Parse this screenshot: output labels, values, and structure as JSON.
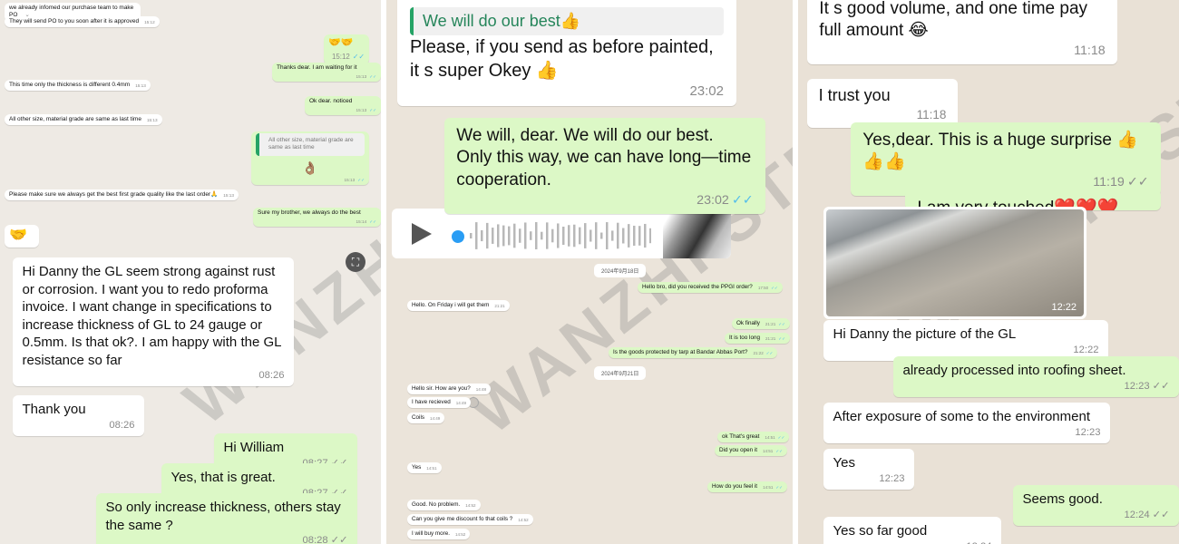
{
  "watermark": "WANZHI STEEL",
  "colors": {
    "incoming": "#ffffff",
    "outgoing": "#dcf8c6",
    "read_ticks": "#53bdeb",
    "quote_bar": "#25a366"
  },
  "left": {
    "messages": [
      {
        "dir": "in",
        "text": "we already infomed our purchase team to make PO",
        "time": "",
        "menu": "chevron-down"
      },
      {
        "dir": "in",
        "text": "They will send PO to you soon after it is approved",
        "time": "15:12"
      },
      {
        "dir": "out",
        "text": "🤝🤝",
        "time": "15:12",
        "ticks": "✓✓"
      },
      {
        "dir": "out",
        "text": "Thanks dear. I am waiting for it",
        "time": "15:13",
        "ticks": "✓✓"
      },
      {
        "dir": "in",
        "text": "This time only the thickness is different 0.4mm",
        "time": "15:13"
      },
      {
        "dir": "out",
        "text": "Ok dear. noticed",
        "time": "15:13",
        "ticks": "✓✓"
      },
      {
        "dir": "in",
        "text": "All other size, material grade are same as last time",
        "time": "15:13"
      },
      {
        "dir": "out",
        "quote": "All other size, material grade are same as last time",
        "text": "👌🏽",
        "time": "15:13",
        "ticks": "✓✓"
      },
      {
        "dir": "in",
        "text": "Please make sure we always get the best first grade quality like the last order🙏",
        "time": "15:13"
      },
      {
        "dir": "out",
        "text": "Sure my brother, we always do the best",
        "time": "15:14",
        "ticks": "✓✓"
      },
      {
        "dir": "in",
        "text": "🤝",
        "time": ""
      },
      {
        "dir": "in",
        "text": "Hi Danny the GL seem strong against rust or corrosion. I want you to redo proforma invoice. I want change in specifications to increase thickness of GL to 24 gauge or 0.5mm. Is that ok?. I am happy with the GL resistance so far",
        "time": "08:26"
      },
      {
        "dir": "in",
        "text": "Thank you",
        "time": "08:26"
      },
      {
        "dir": "out",
        "text": "Hi William",
        "time": "08:27",
        "ticks": "✓✓"
      },
      {
        "dir": "out",
        "text": "Yes, that is great.",
        "time": "08:27",
        "ticks": "✓✓"
      },
      {
        "dir": "out",
        "text": "So only increase thickness, others stay the same ?",
        "time": "08:28",
        "ticks": "✓✓"
      }
    ]
  },
  "middle": {
    "messages": [
      {
        "dir": "in",
        "quote": "We will do our best👍",
        "text": "Please, if you send as before painted, it s super Okey 👍",
        "time": "23:02"
      },
      {
        "dir": "out",
        "text": "We will, dear. We will do our best. Only this way, we can have long—time cooperation.",
        "time": "23:02",
        "ticks": "✓✓"
      },
      {
        "dir": "out",
        "text": "Hello bro, did you received the PPGI order?",
        "time": "17:50",
        "ticks": "✓✓"
      },
      {
        "dir": "in",
        "text": "Hello. On Friday i will get them",
        "time": "21:21"
      },
      {
        "dir": "out",
        "text": "Ok finally",
        "time": "21:21",
        "ticks": "✓✓"
      },
      {
        "dir": "out",
        "text": "It is too long",
        "time": "21:21",
        "ticks": "✓✓"
      },
      {
        "dir": "out",
        "text": "Is the goods protected by tarp at Bandar Abbas Port?",
        "time": "21:22",
        "ticks": "✓✓"
      },
      {
        "dir": "in",
        "text": "Hello sir. How are you?",
        "time": "14:48"
      },
      {
        "dir": "in",
        "text": "I have recieved",
        "time": "14:49"
      },
      {
        "dir": "in",
        "text": "Coils",
        "time": "14:49"
      },
      {
        "dir": "out",
        "text": "ok That's great",
        "time": "14:51",
        "ticks": "✓✓"
      },
      {
        "dir": "out",
        "text": "Did you open it",
        "time": "14:51",
        "ticks": "✓✓"
      },
      {
        "dir": "in",
        "text": "Yes",
        "time": "14:51"
      },
      {
        "dir": "out",
        "text": "How do you feel it",
        "time": "14:51",
        "ticks": "✓✓"
      },
      {
        "dir": "in",
        "text": "Good. No problem.",
        "time": "14:52"
      },
      {
        "dir": "in",
        "text": "Can you give me discount fo that coils ?",
        "time": "14:52"
      },
      {
        "dir": "in",
        "text": "I will buy more.",
        "time": "14:52"
      }
    ],
    "dates": [
      "2024年9月18日",
      "2024年9月21日"
    ],
    "voice": {
      "icon": "play-icon"
    }
  },
  "right": {
    "messages": [
      {
        "dir": "in",
        "text": "It s good volume, and one time pay full amount 😂",
        "time": "11:18"
      },
      {
        "dir": "in",
        "text": "I trust you",
        "time": "11:18"
      },
      {
        "dir": "out",
        "text": "Yes,dear. This is a huge surprise 👍👍👍",
        "time": "11:19",
        "ticks": "✓✓"
      },
      {
        "dir": "out",
        "text": "I am very touched❤️❤️❤️",
        "time": ""
      },
      {
        "dir": "in",
        "text": "Hi Danny the picture of the GL",
        "time": "12:22"
      },
      {
        "dir": "out",
        "text": "already processed into roofing sheet.",
        "time": "12:23",
        "ticks": "✓✓"
      },
      {
        "dir": "in",
        "text": "After exposure of some to the environment",
        "time": "12:23"
      },
      {
        "dir": "in",
        "text": "Yes",
        "time": "12:23"
      },
      {
        "dir": "out",
        "text": "Seems good.",
        "time": "12:24",
        "ticks": "✓✓"
      },
      {
        "dir": "in",
        "text": "Yes so far good",
        "time": "12:24"
      }
    ],
    "photo": {
      "time": "12:22"
    }
  }
}
